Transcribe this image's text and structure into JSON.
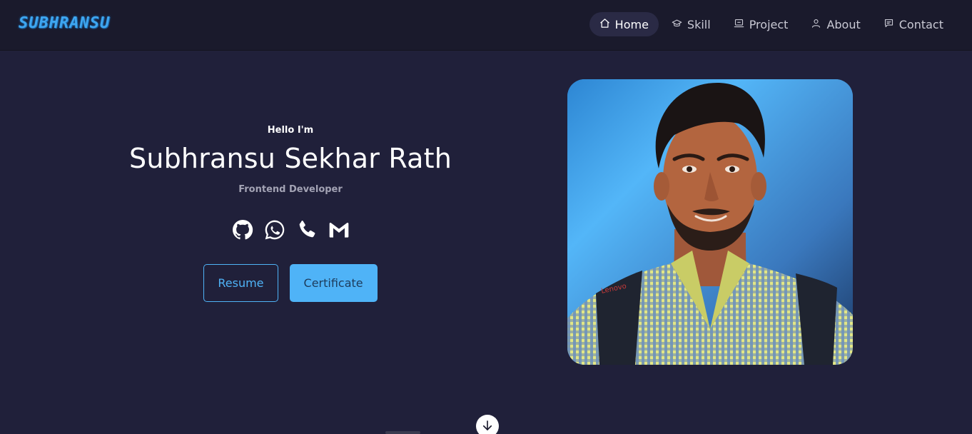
{
  "brand": "SUBHRANSU",
  "nav": {
    "items": [
      {
        "label": "Home",
        "icon": "home-icon",
        "active": true
      },
      {
        "label": "Skill",
        "icon": "graduation-cap-icon"
      },
      {
        "label": "Project",
        "icon": "laptop-icon"
      },
      {
        "label": "About",
        "icon": "user-icon"
      },
      {
        "label": "Contact",
        "icon": "message-icon"
      }
    ]
  },
  "hero": {
    "greeting": "Hello I'm",
    "name": "Subhransu Sekhar Rath",
    "role": "Frontend Developer",
    "socials": [
      "github-icon",
      "whatsapp-icon",
      "phone-icon",
      "gmail-icon"
    ],
    "resume_label": "Resume",
    "certificate_label": "Certificate"
  },
  "photo": {
    "alt": "profile-photo"
  },
  "colors": {
    "background": "#20203a",
    "navbar": "#1a1a2c",
    "accent": "#4fb3f7",
    "brand": "#3ea6f0"
  }
}
